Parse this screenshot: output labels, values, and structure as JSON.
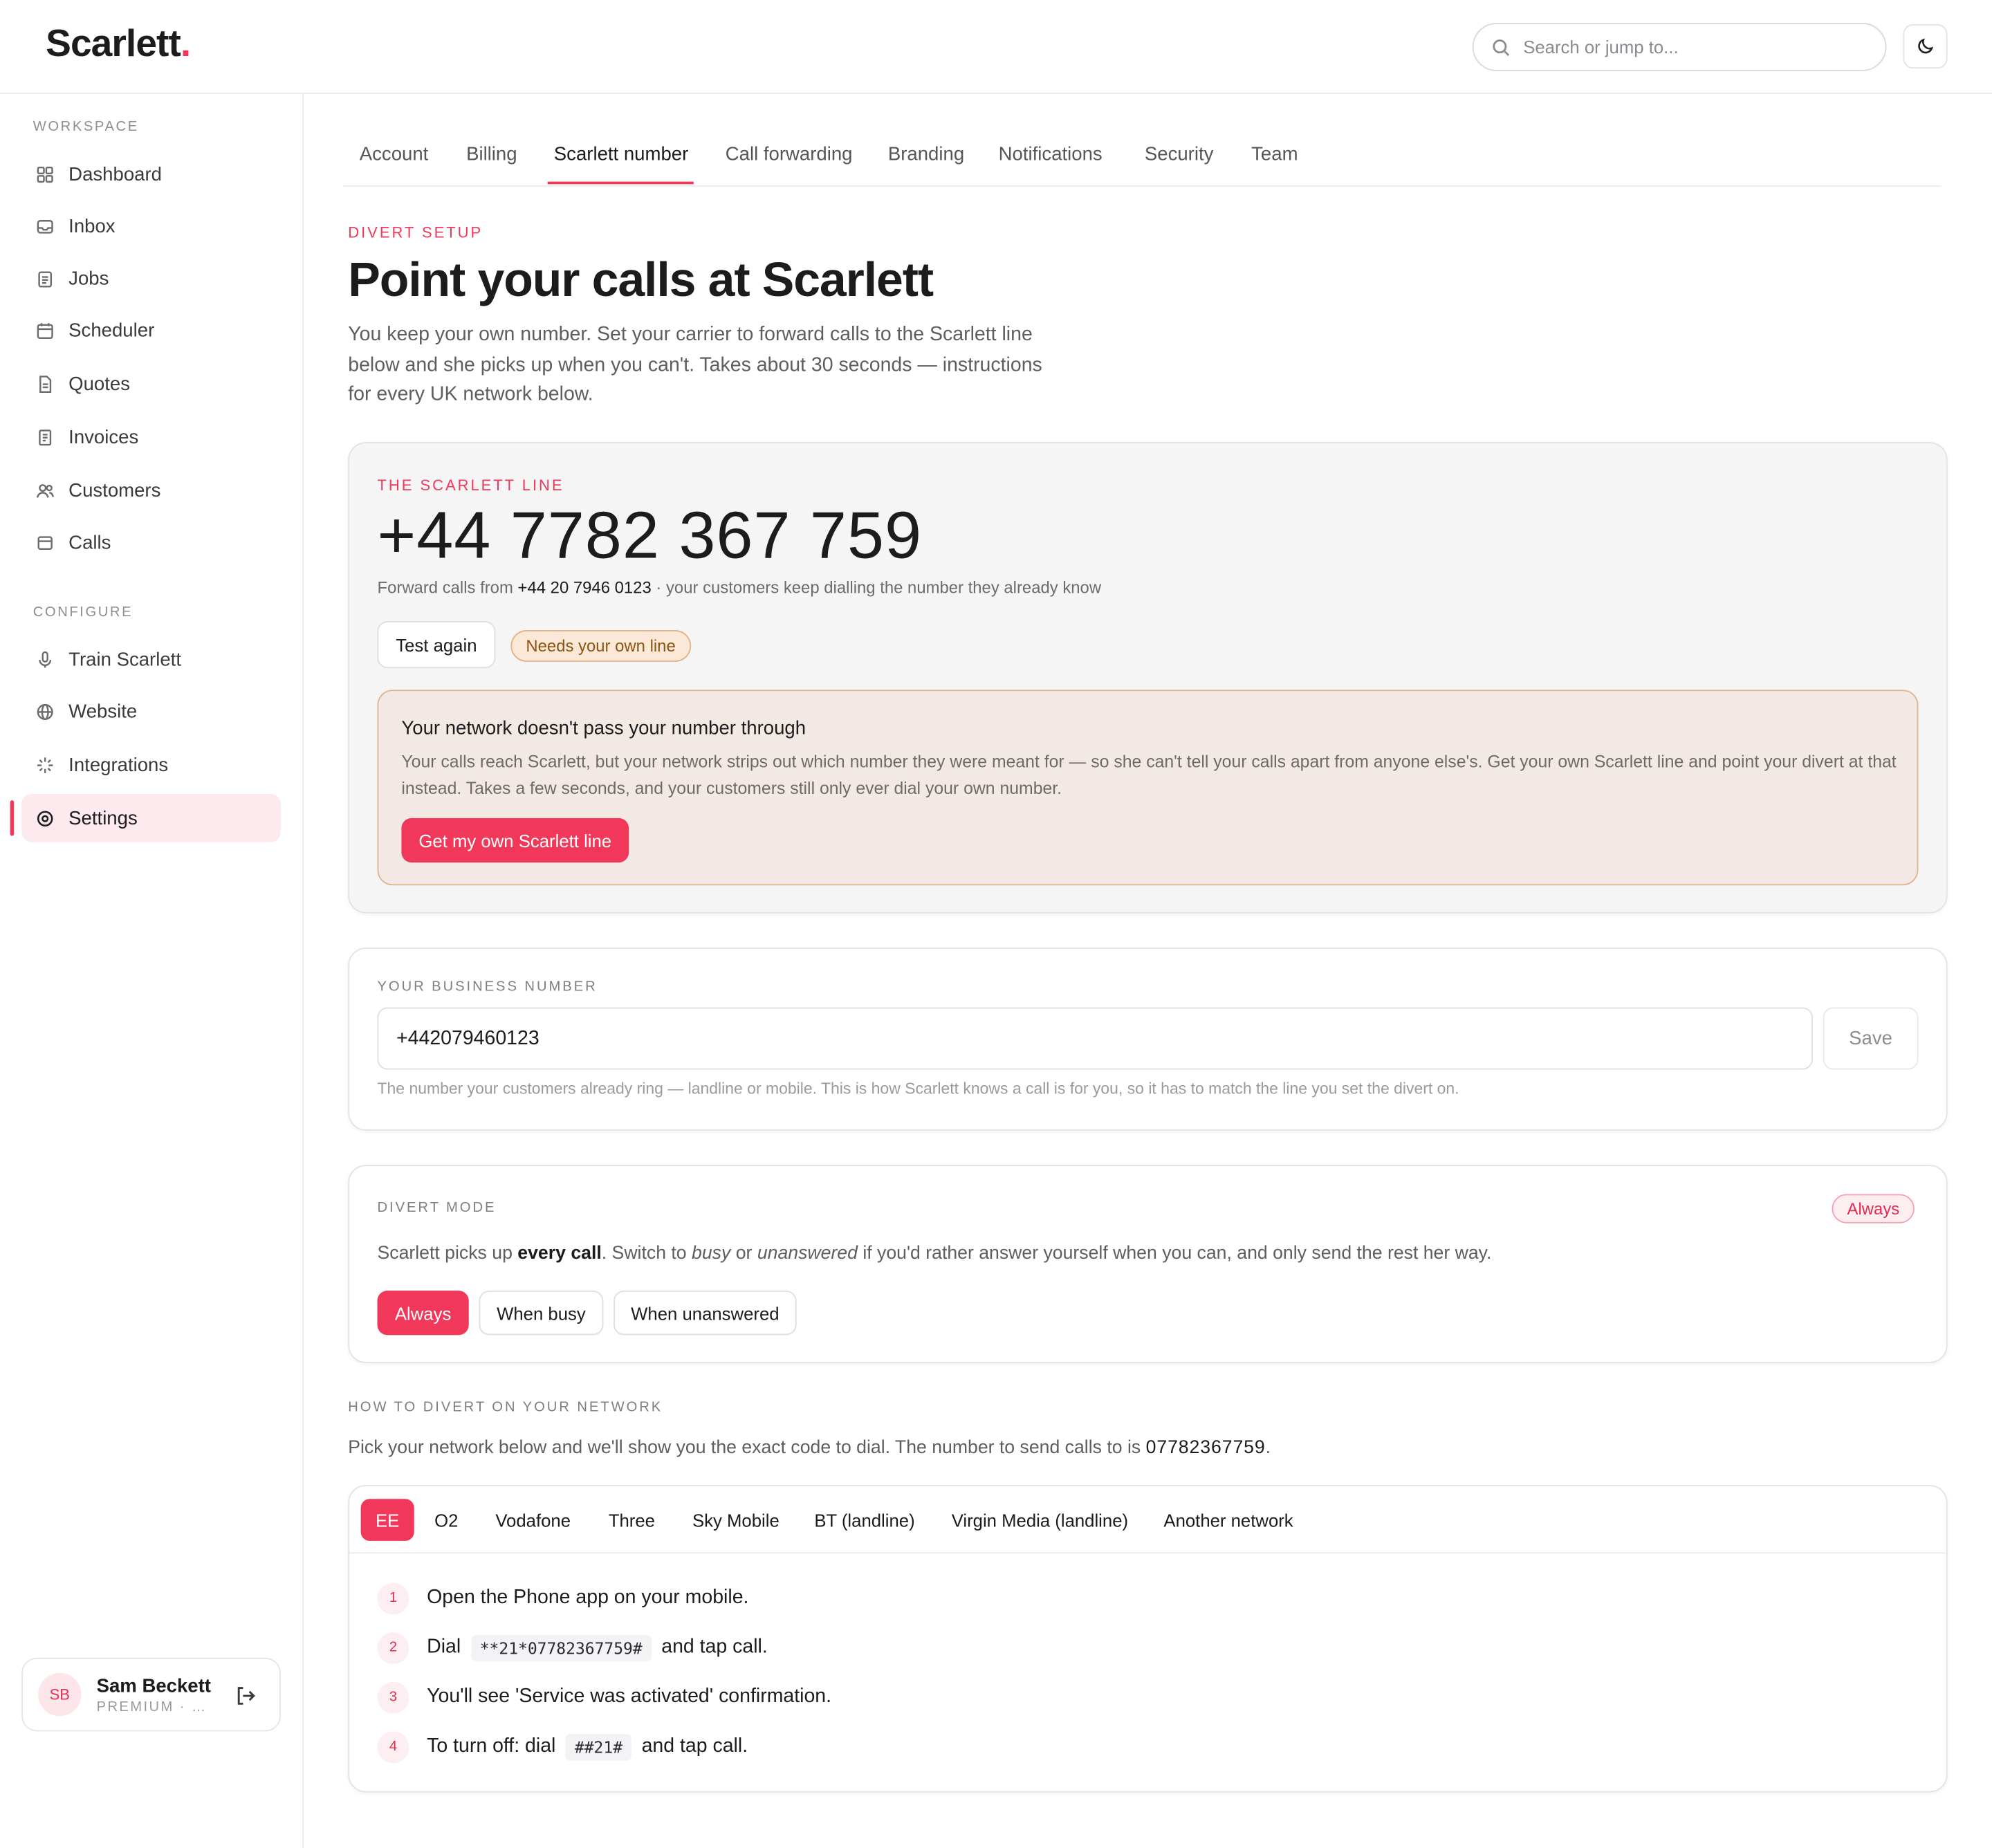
{
  "brand": {
    "name": "Scarlett",
    "dot": ".",
    "accent": "#f2385a"
  },
  "search": {
    "placeholder": "Search or jump to..."
  },
  "sidebar": {
    "workspace_label": "WORKSPACE",
    "configure_label": "CONFIGURE",
    "workspace_items": [
      {
        "label": "Dashboard",
        "icon": "grid-icon"
      },
      {
        "label": "Inbox",
        "icon": "inbox-icon"
      },
      {
        "label": "Jobs",
        "icon": "clipboard-icon"
      },
      {
        "label": "Scheduler",
        "icon": "calendar-icon"
      },
      {
        "label": "Quotes",
        "icon": "document-icon"
      },
      {
        "label": "Invoices",
        "icon": "receipt-icon"
      },
      {
        "label": "Customers",
        "icon": "users-icon"
      },
      {
        "label": "Calls",
        "icon": "card-icon"
      }
    ],
    "configure_items": [
      {
        "label": "Train Scarlett",
        "icon": "microphone-icon"
      },
      {
        "label": "Website",
        "icon": "globe-icon"
      },
      {
        "label": "Integrations",
        "icon": "sparkle-icon"
      },
      {
        "label": "Settings",
        "icon": "settings-icon",
        "active": true
      }
    ],
    "user": {
      "initials": "SB",
      "name": "Sam Beckett",
      "plan": "PREMIUM · S..."
    }
  },
  "tabs": [
    "Account",
    "Billing",
    "Scarlett number",
    "Call forwarding",
    "Branding",
    "Notifications",
    "Security",
    "Team"
  ],
  "active_tab": "Scarlett number",
  "intro": {
    "eyebrow": "DIVERT SETUP",
    "title": "Point your calls at Scarlett",
    "lede": "You keep your own number. Set your carrier to forward calls to the Scarlett line below and she picks up when you can't. Takes about 30 seconds — instructions for every UK network below."
  },
  "scarlett_line": {
    "eyebrow": "THE SCARLETT LINE",
    "number": "+44 7782 367 759",
    "forward_prefix": "Forward calls from",
    "forward_from": "+44 20 7946 0123",
    "forward_suffix": "· your customers keep dialling the number they already know",
    "test_button": "Test again",
    "status_pill": "Needs your own line",
    "warning": {
      "title": "Your network doesn't pass your number through",
      "body": "Your calls reach Scarlett, but your network strips out which number they were meant for — so she can't tell your calls apart from anyone else's. Get your own Scarlett line and point your divert at that instead. Takes a few seconds, and your customers still only ever dial your own number.",
      "cta": "Get my own Scarlett line"
    }
  },
  "business_number": {
    "eyebrow": "YOUR BUSINESS NUMBER",
    "value": "+442079460123",
    "save": "Save",
    "hint": "The number your customers already ring — landline or mobile. This is how Scarlett knows a call is for you, so it has to match the line you set the divert on."
  },
  "divert_mode": {
    "eyebrow": "DIVERT MODE",
    "badge": "Always",
    "desc_1": "Scarlett picks up",
    "desc_bold": "every call",
    "desc_2": ". Switch to",
    "desc_em1": "busy",
    "desc_3": "or",
    "desc_em2": "unanswered",
    "desc_4": "if you'd rather answer yourself when you can, and only send the rest her way.",
    "options": [
      "Always",
      "When busy",
      "When unanswered"
    ],
    "selected": "Always"
  },
  "howto": {
    "eyebrow": "HOW TO DIVERT ON YOUR NETWORK",
    "desc": "Pick your network below and we'll show you the exact code to dial. The number to send calls to is",
    "target": "07782367759",
    "networks": [
      "EE",
      "O2",
      "Vodafone",
      "Three",
      "Sky Mobile",
      "BT (landline)",
      "Virgin Media (landline)",
      "Another network"
    ],
    "selected_network": "EE",
    "steps": [
      {
        "n": "1",
        "text": "Open the Phone app on your mobile."
      },
      {
        "n": "2",
        "pre": "Dial",
        "code": "**21*07782367759#",
        "post": "and tap call."
      },
      {
        "n": "3",
        "text": "You'll see 'Service was activated' confirmation."
      },
      {
        "n": "4",
        "pre": "To turn off: dial",
        "code": "##21#",
        "post": "and tap call."
      }
    ]
  }
}
